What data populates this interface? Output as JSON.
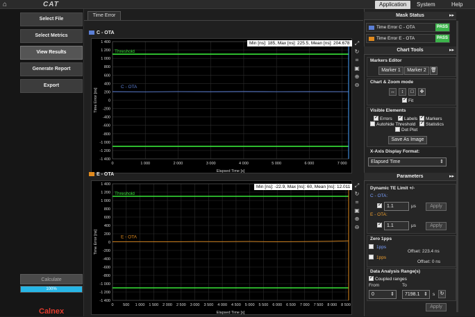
{
  "topbar": {
    "logo": "CAT",
    "menus": [
      "Application",
      "System",
      "Help"
    ]
  },
  "left": {
    "buttons": [
      "Select File",
      "Select Metrics",
      "View Results",
      "Generate Report",
      "Export"
    ],
    "calculate": "Calculate",
    "progress_label": "100%",
    "progress": 1.0,
    "brand": "Calnex"
  },
  "tab": "Time Error",
  "charts": [
    {
      "title": "C - OTA",
      "color": "#5b7fd6",
      "stats": "Min [ns]: 185, Max [ns]: 225.5, Mean [ns]: 204.678",
      "threshold_label": "Threshold",
      "series_label": "C - OTA",
      "xlabel": "Elapsed Time [s]",
      "ylabel": "Time Error [ns]",
      "yticks": [
        "1 400",
        "1 200",
        "1 000",
        "800",
        "600",
        "400",
        "200",
        "0",
        "-200",
        "-400",
        "-600",
        "-800",
        "-1 000",
        "-1 200",
        "-1 400"
      ],
      "xticks": [
        "0",
        "1 000",
        "2 000",
        "3 000",
        "4 000",
        "5 000",
        "6 000",
        "7 000"
      ]
    },
    {
      "title": "E - OTA",
      "color": "#e08a1e",
      "stats": "Min [ns]: -22.9, Max [ns]: 60, Mean [ns]: 12.011",
      "threshold_label": "Threshold",
      "series_label": "E - OTA",
      "xlabel": "Elapsed Time [s]",
      "ylabel": "Time Error [ns]",
      "yticks": [
        "1 400",
        "1 200",
        "1 000",
        "800",
        "600",
        "400",
        "200",
        "0",
        "-200",
        "-400",
        "-600",
        "-800",
        "-1 000",
        "-1 200",
        "-1 400"
      ],
      "xticks": [
        "0",
        "500",
        "1 000",
        "1 500",
        "2 000",
        "2 500",
        "3 000",
        "3 500",
        "4 000",
        "4 500",
        "5 000",
        "5 500",
        "6 000",
        "6 500",
        "7 000",
        "7 500",
        "8 000",
        "8 500"
      ]
    }
  ],
  "chart_data": [
    {
      "type": "line",
      "title": "C - OTA",
      "xlabel": "Elapsed Time [s]",
      "ylabel": "Time Error [ns]",
      "xlim": [
        0,
        7198.1
      ],
      "ylim": [
        -1400,
        1400
      ],
      "series": [
        {
          "name": "C - OTA",
          "x": [
            0,
            1000,
            2000,
            3000,
            4000,
            5000,
            6000,
            7198
          ],
          "values": [
            205,
            200,
            206,
            203,
            207,
            204,
            205,
            204
          ]
        },
        {
          "name": "Threshold",
          "x": [
            0,
            7198
          ],
          "values": [
            1100,
            1100
          ]
        },
        {
          "name": "Threshold",
          "x": [
            0,
            7198
          ],
          "values": [
            -1100,
            -1100
          ]
        }
      ]
    },
    {
      "type": "line",
      "title": "E - OTA",
      "xlabel": "Elapsed Time [s]",
      "ylabel": "Time Error [ns]",
      "xlim": [
        0,
        8600
      ],
      "ylim": [
        -1400,
        1400
      ],
      "series": [
        {
          "name": "E - OTA",
          "x": [
            0,
            1000,
            2000,
            3000,
            4000,
            5000,
            6000,
            7000,
            8000,
            8600
          ],
          "values": [
            10,
            12,
            8,
            14,
            11,
            15,
            9,
            13,
            20,
            30
          ]
        },
        {
          "name": "Threshold",
          "x": [
            0,
            8600
          ],
          "values": [
            1100,
            1100
          ]
        },
        {
          "name": "Threshold",
          "x": [
            0,
            8600
          ],
          "values": [
            -1100,
            -1100
          ]
        }
      ]
    }
  ],
  "right": {
    "mask_status": {
      "title": "Mask Status",
      "rows": [
        {
          "label": "Time Error C - OTA",
          "status": "PASS",
          "color": "#5b7fd6"
        },
        {
          "label": "Time Error E - OTA",
          "status": "PASS",
          "color": "#e08a1e"
        }
      ]
    },
    "chart_tools": {
      "title": "Chart Tools",
      "markers_editor": "Markers Editor",
      "marker1": "Marker 1",
      "marker2": "Marker 2",
      "zoom_mode": "Chart & Zoom mode",
      "fit": "Fit",
      "visible_elements": "Visible Elements",
      "errors": "Errors",
      "labels": "Labels",
      "markers": "Markers",
      "autohide": "Autohide Threshold",
      "statistics": "Statistics",
      "dot_plot": "Dot Plot",
      "save_image": "Save As Image",
      "x_axis_format": "X-Axis Display Format:",
      "x_axis_value": "Elapsed Time"
    },
    "parameters": {
      "title": "Parameters",
      "dynamic_te": "Dynamic TE Limit +/-",
      "c_ota": "C - OTA:",
      "e_ota": "E - OTA:",
      "c_value": "1.1",
      "e_value": "1.1",
      "unit": "μs",
      "apply": "Apply",
      "zero_1pps": "Zero 1pps",
      "pps1": "1pps",
      "pps2": "1pps",
      "offset1": "Offset: 223.4 ns",
      "offset2": "Offset: 0 ns",
      "analysis_range": "Data Analysis Range(s)",
      "coupled": "Coupled ranges",
      "from_label": "From",
      "to_label": "To",
      "from_value": "0",
      "to_value": "7198.1",
      "range_unit": "s"
    }
  }
}
